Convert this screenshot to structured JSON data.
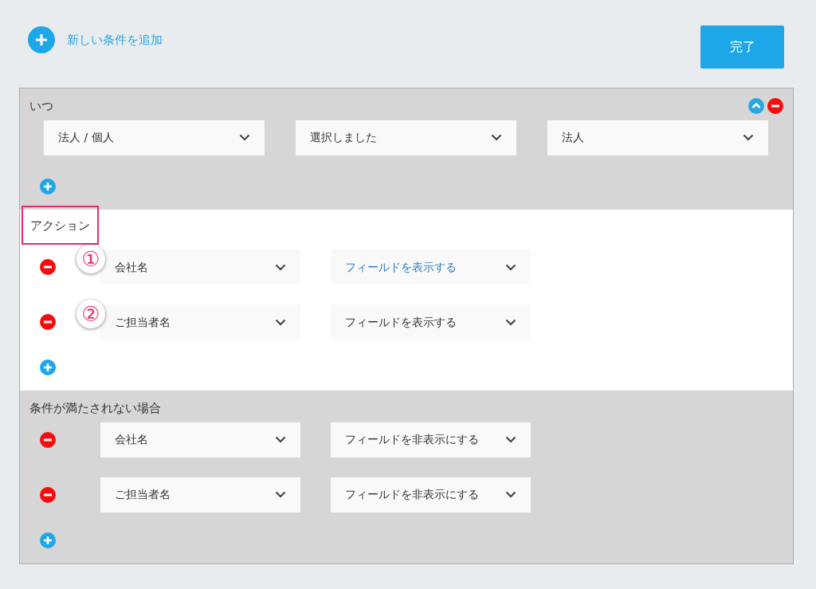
{
  "add_condition": {
    "label": "新しい条件を追加"
  },
  "done_button": {
    "label": "完了"
  },
  "sections": [
    {
      "kind": "filter",
      "color": "#d6d6d6",
      "title": "いつ",
      "outlined": false,
      "rows": [
        {
          "dropdowns": [
            {
              "value": "法人 / 個人",
              "highlighted": false
            },
            {
              "value": "選択しました",
              "highlighted": false
            },
            {
              "value": "法人",
              "highlighted": false
            }
          ]
        }
      ]
    },
    {
      "kind": "rules",
      "color": "#ffffff",
      "title": "アクション",
      "outlined": true,
      "rows": [
        {
          "marker": "①",
          "dropdowns": [
            {
              "value": "会社名",
              "highlighted": false
            },
            {
              "value": "フィールドを表示する",
              "highlighted": true
            }
          ]
        },
        {
          "marker": "②",
          "dropdowns": [
            {
              "value": "ご担当者名",
              "highlighted": false
            },
            {
              "value": "フィールドを表示する",
              "highlighted": false
            }
          ]
        }
      ]
    },
    {
      "kind": "rules",
      "color": "#d6d6d6",
      "title": "条件が満たされない場合",
      "outlined": false,
      "rows": [
        {
          "dropdowns": [
            {
              "value": "会社名",
              "highlighted": false
            },
            {
              "value": "フィールドを非表示にする",
              "highlighted": false
            }
          ]
        },
        {
          "dropdowns": [
            {
              "value": "ご担当者名",
              "highlighted": false
            },
            {
              "value": "フィールドを非表示にする",
              "highlighted": false
            }
          ]
        }
      ]
    }
  ]
}
